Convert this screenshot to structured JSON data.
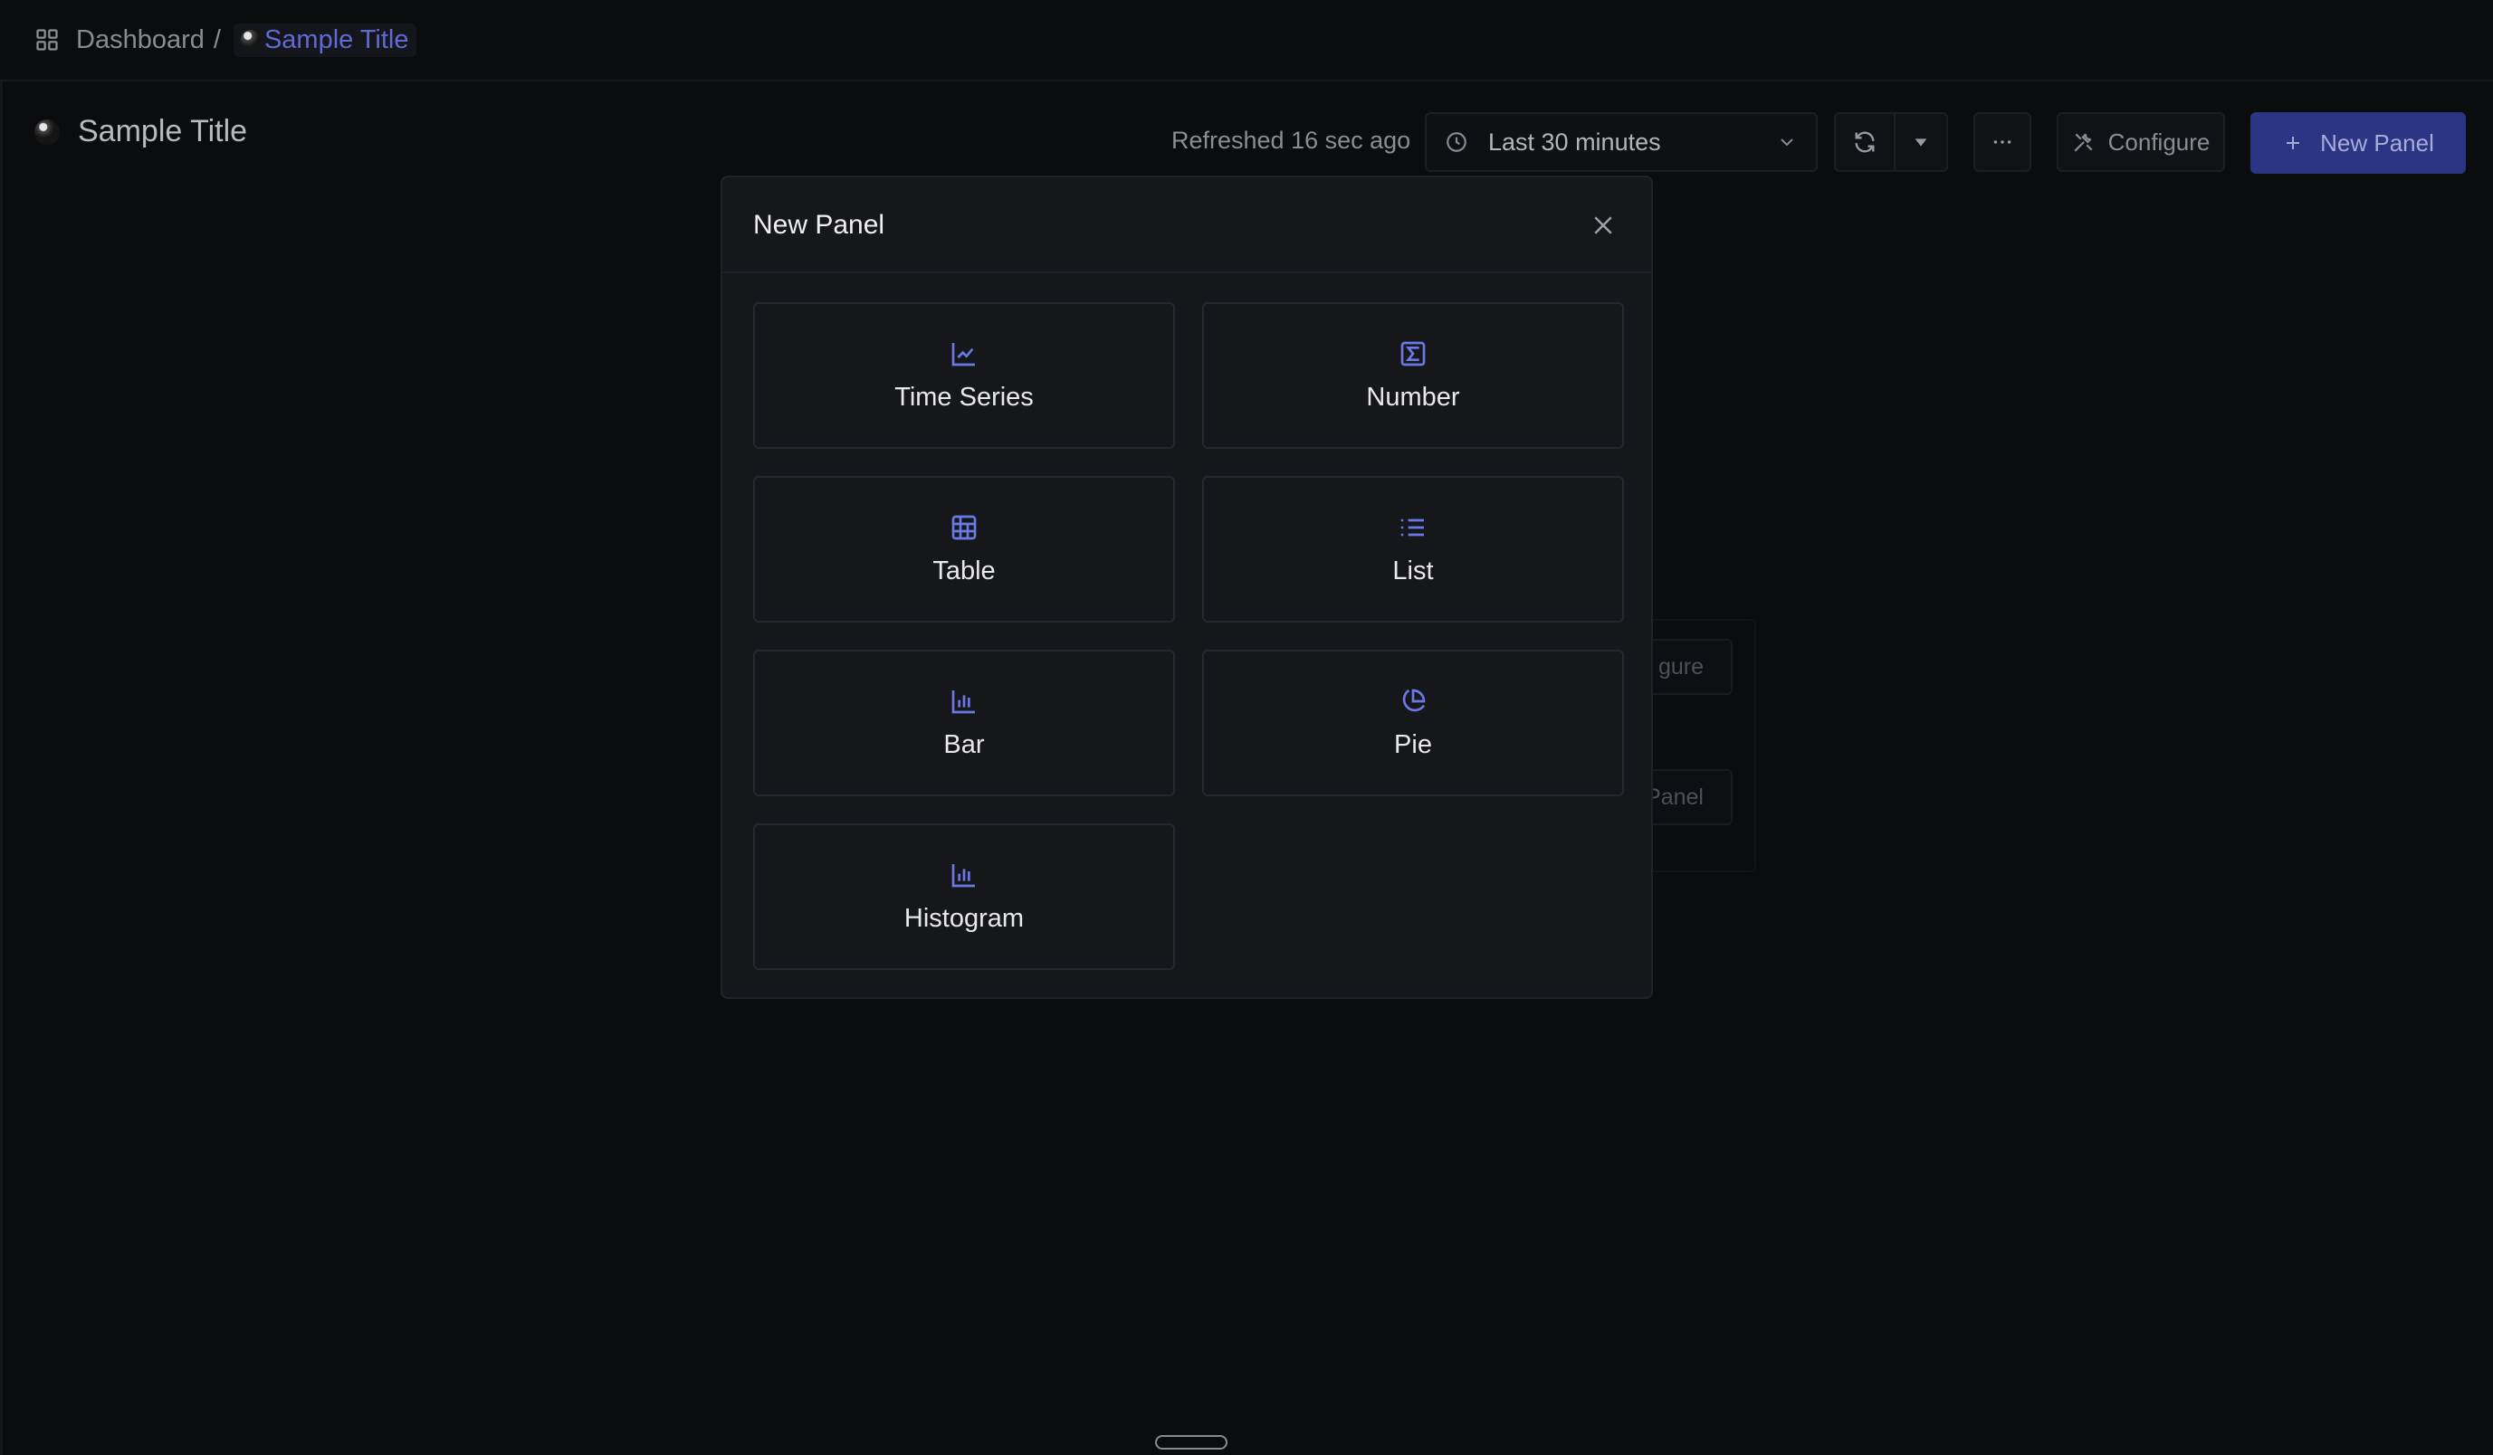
{
  "breadcrumb": {
    "root_label": "Dashboard",
    "separator": "/",
    "current_label": "Sample Title"
  },
  "header": {
    "title": "Sample Title",
    "refreshed_text": "Refreshed 16 sec ago",
    "time_range": "Last 30 minutes",
    "configure_label": "Configure",
    "new_panel_label": "New Panel"
  },
  "background": {
    "configure_fragment": "gure",
    "new_panel_fragment": "Panel"
  },
  "modal": {
    "title": "New Panel",
    "tiles": [
      {
        "label": "Time Series",
        "icon": "line-chart-icon"
      },
      {
        "label": "Number",
        "icon": "sigma-icon"
      },
      {
        "label": "Table",
        "icon": "table-icon"
      },
      {
        "label": "List",
        "icon": "list-icon"
      },
      {
        "label": "Bar",
        "icon": "bar-chart-icon"
      },
      {
        "label": "Pie",
        "icon": "pie-chart-icon"
      },
      {
        "label": "Histogram",
        "icon": "histogram-icon"
      }
    ]
  },
  "colors": {
    "accent": "#5e6bd1",
    "primary_button": "#2c3583",
    "modal_bg": "#16171b",
    "page_bg": "#0b0c0e"
  }
}
